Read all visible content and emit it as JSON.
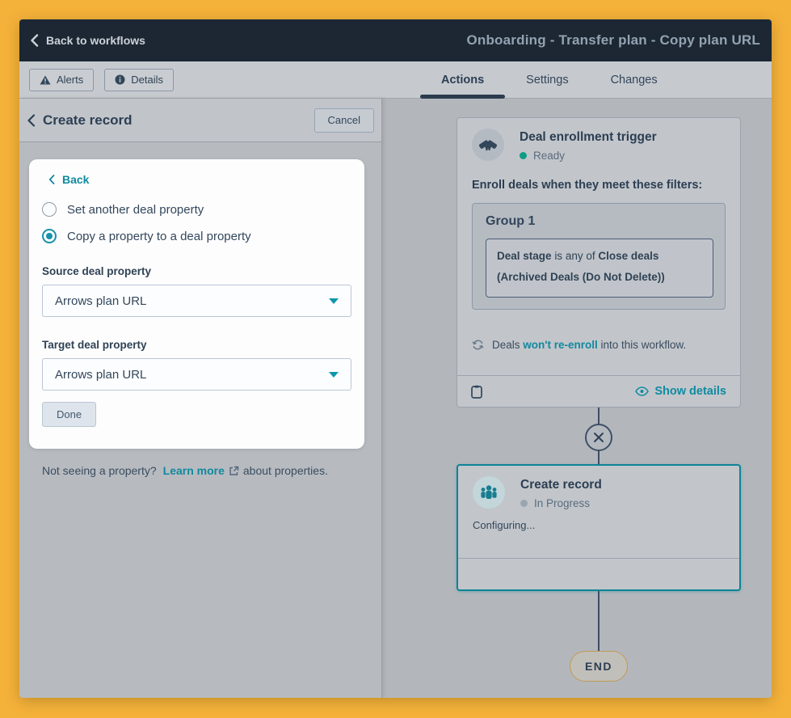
{
  "header": {
    "back_label": "Back to workflows",
    "title": "Onboarding - Transfer plan - Copy plan URL"
  },
  "toolbar": {
    "alerts_label": "Alerts",
    "details_label": "Details",
    "tabs": [
      {
        "label": "Actions",
        "active": true
      },
      {
        "label": "Settings",
        "active": false
      },
      {
        "label": "Changes",
        "active": false
      }
    ]
  },
  "panel": {
    "title": "Create record",
    "cancel_label": "Cancel",
    "back_label": "Back",
    "radio_options": [
      {
        "label": "Set another deal property",
        "selected": false
      },
      {
        "label": "Copy a property to a deal property",
        "selected": true
      }
    ],
    "source_label": "Source deal property",
    "source_value": "Arrows plan URL",
    "target_label": "Target deal property",
    "target_value": "Arrows plan URL",
    "done_label": "Done",
    "footnote": {
      "prefix": "Not seeing a property?",
      "link_label": "Learn more",
      "suffix": "about properties."
    }
  },
  "canvas": {
    "trigger_card": {
      "title": "Deal enrollment trigger",
      "status": "Ready",
      "enroll_label": "Enroll deals when they meet these filters:",
      "group_title": "Group 1",
      "filter": {
        "property": "Deal stage",
        "operator": "is any of",
        "value": "Close deals (Archived Deals (Do Not Delete))"
      },
      "reenroll": {
        "prefix": "Deals",
        "bold": "won't re-enroll",
        "suffix": "into this workflow."
      },
      "show_details_label": "Show details"
    },
    "action_card": {
      "title": "Create record",
      "status": "In Progress",
      "body": "Configuring..."
    },
    "end_label": "END"
  },
  "colors": {
    "frame_orange": "#f5b23a",
    "header_navy": "#1c2733",
    "text_navy": "#33475b",
    "accent_teal": "#11899e",
    "active_card_border": "#0e8396",
    "status_ready_green": "#0e9c84",
    "status_progress_gray": "#9aa5b0",
    "end_pill_border": "#c09a55"
  }
}
